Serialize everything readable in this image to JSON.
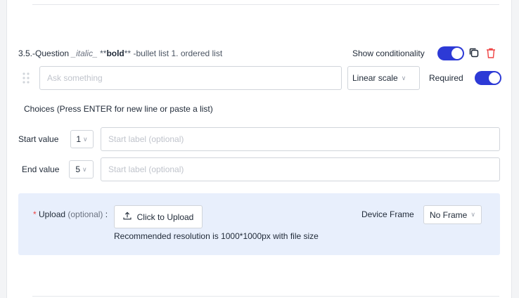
{
  "question": {
    "number": "3.5.-",
    "title_word": "Question",
    "italic_sample": "_italic_",
    "bold_prefix": "**",
    "bold_word": "bold",
    "bold_suffix": "**",
    "rest": "-bullet list 1. ordered list",
    "show_conditionality_label": "Show conditionality",
    "show_conditionality_on": true,
    "input_placeholder": "Ask something",
    "type_select": "Linear scale",
    "required_label": "Required",
    "required_on": true
  },
  "choices_hint": "Choices (Press ENTER for new line or paste a list)",
  "start": {
    "label": "Start value",
    "value": "1",
    "label_placeholder": "Start label (optional)"
  },
  "end": {
    "label": "End value",
    "value": "5",
    "label_placeholder": "Start label (optional)"
  },
  "upload": {
    "required_mark": "*",
    "label": "Upload",
    "optional": "(optional)",
    "colon": ":",
    "button_label": "Click to Upload",
    "hint": "Recommended resolution is 1000*1000px with file size",
    "device_frame_label": "Device Frame",
    "device_frame_value": "No Frame"
  },
  "colors": {
    "accent": "#2d3ad6",
    "danger": "#ef4444",
    "panel": "#e8effc"
  }
}
